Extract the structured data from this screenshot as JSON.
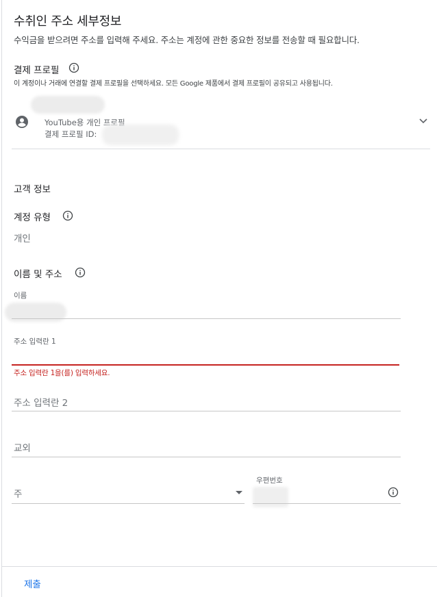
{
  "header": {
    "title": "수취인 주소 세부정보",
    "subtitle": "수익금을 받으려면 주소를 입력해 주세요. 주소는 계정에 관한 중요한 정보를 전송할 때 필요합니다."
  },
  "payment_profile": {
    "label": "결제 프로필",
    "description": "이 계정이나 거래에 연결할 결제 프로필을 선택하세요. 모든 Google 제품에서 결제 프로필이 공유되고 사용됩니다.",
    "profile_type": "YouTube용 개인 프로필",
    "profile_id_label": "결제 프로필 ID:"
  },
  "customer_info": {
    "heading": "고객 정보",
    "account_type_label": "계정 유형",
    "account_type_value": "개인",
    "name_address_label": "이름 및 주소",
    "name_label": "이름",
    "address1_label": "주소 입력란 1",
    "address1_error": "주소 입력란 1을(를) 입력하세요.",
    "address2_placeholder": "주소 입력란 2",
    "city_placeholder": "교외",
    "state_placeholder": "주",
    "postal_label": "우편번호"
  },
  "footer": {
    "submit_label": "제출"
  },
  "colors": {
    "accent": "#1a73e8",
    "error": "#c5221f",
    "divider": "#dadce0"
  }
}
